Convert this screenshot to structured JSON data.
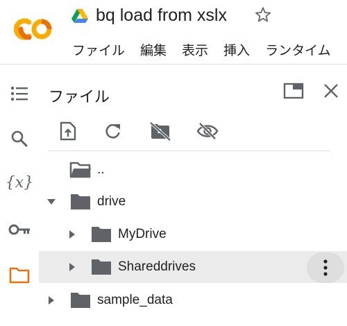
{
  "app": {
    "logo_text": "CO",
    "notebook_title": "bq load from xslx",
    "colors": {
      "logo_orange": "#F9AB00",
      "logo_dark_orange": "#E8710A",
      "folder_active": "#E8710A",
      "icon_gray": "#5f6368"
    }
  },
  "menu": {
    "items": [
      "ファイル",
      "編集",
      "表示",
      "挿入",
      "ランタイム"
    ]
  },
  "rail": {
    "icons": [
      "table-of-contents-icon",
      "search-icon",
      "variables-icon",
      "secrets-key-icon",
      "folder-icon"
    ],
    "variables_glyph": "{x}"
  },
  "files_panel": {
    "title": "ファイル",
    "toolbar": [
      "upload-icon",
      "refresh-icon",
      "mount-drive-icon",
      "hide-files-icon"
    ],
    "tree": [
      {
        "label": "..",
        "type": "parent",
        "expanded": null
      },
      {
        "label": "drive",
        "type": "folder",
        "expanded": true
      },
      {
        "label": "MyDrive",
        "type": "folder",
        "expanded": false
      },
      {
        "label": "Shareddrives",
        "type": "folder",
        "expanded": false,
        "selected": true
      },
      {
        "label": "sample_data",
        "type": "folder",
        "expanded": false
      }
    ]
  }
}
